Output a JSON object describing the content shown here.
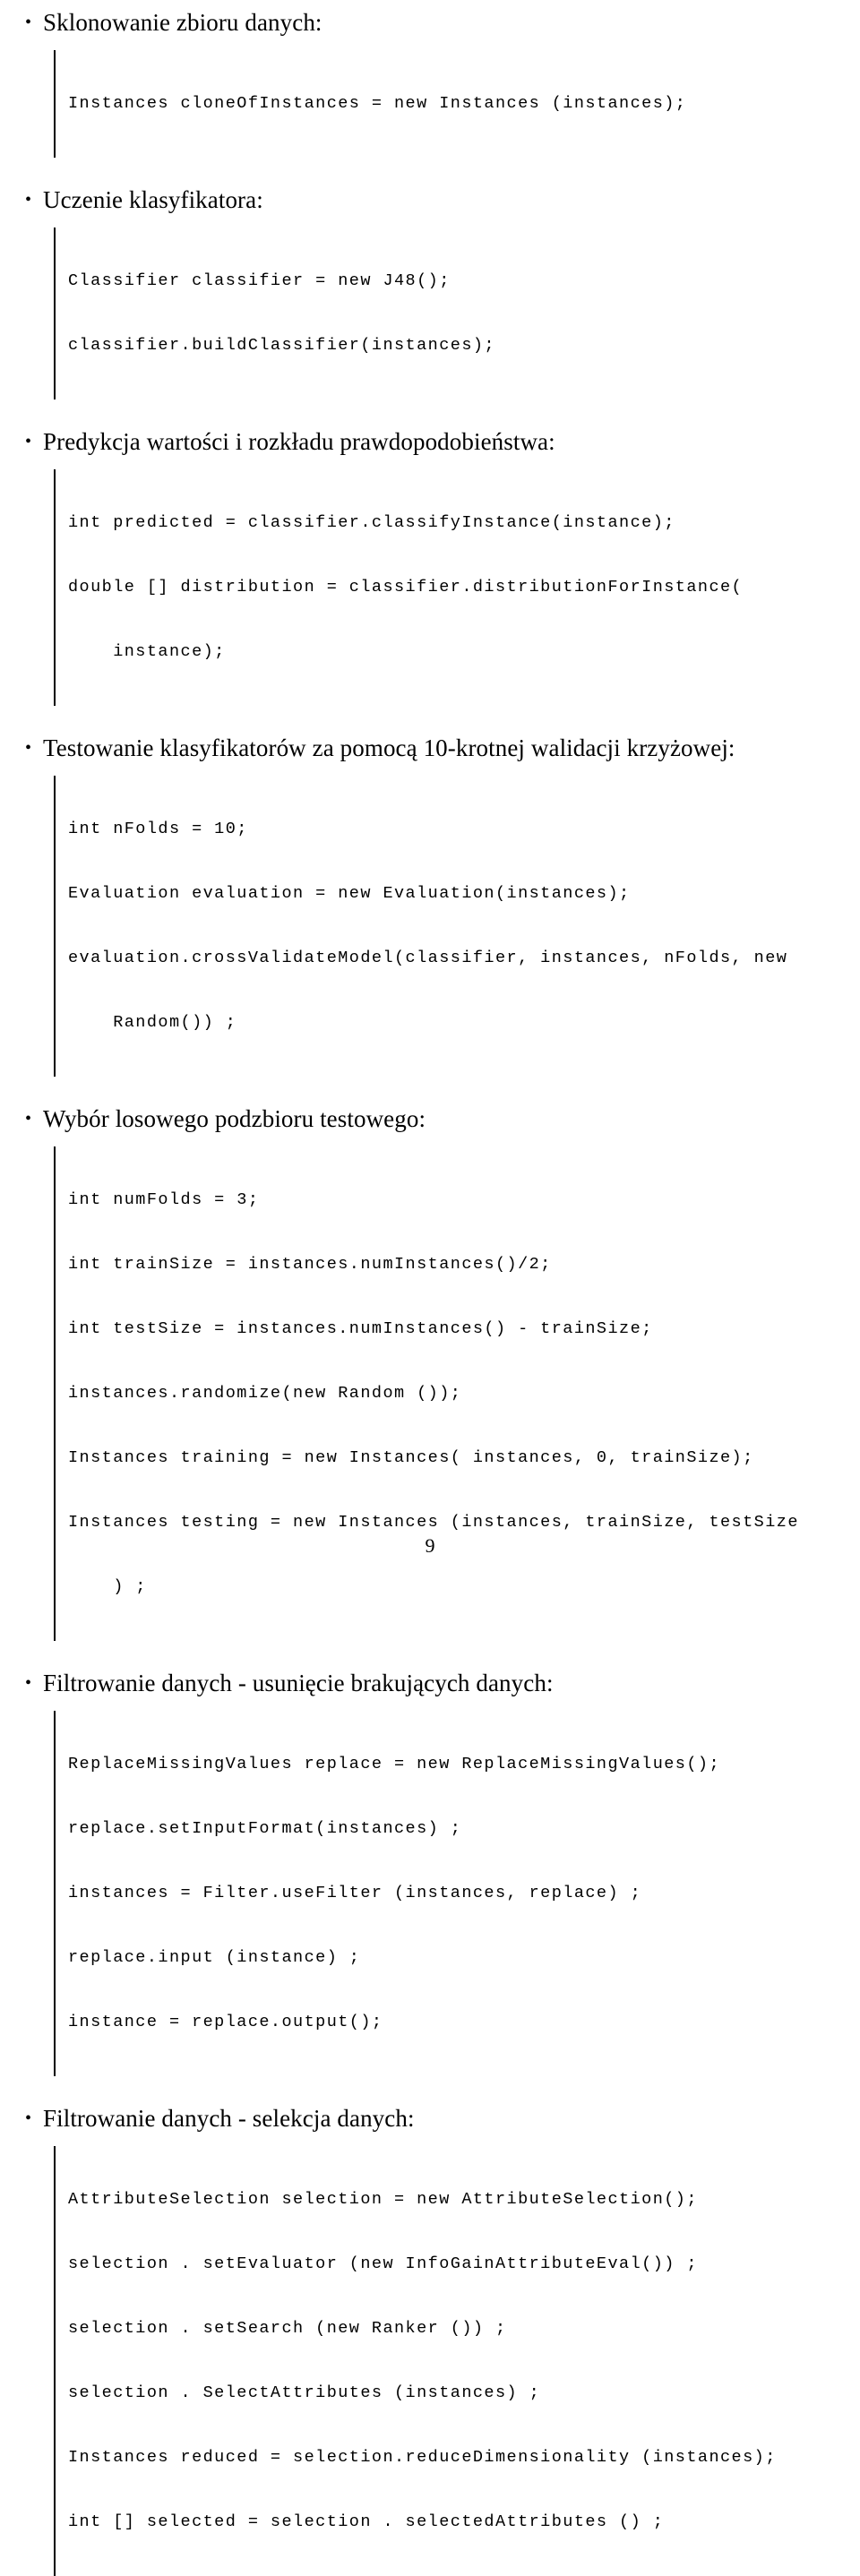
{
  "document": {
    "language": "pl",
    "page_number": "9",
    "sections": [
      {
        "heading": "Sklonowanie zbioru danych:",
        "code": [
          "Instances cloneOfInstances = new Instances (instances);"
        ]
      },
      {
        "heading": "Uczenie klasyfikatora:",
        "code": [
          "Classifier classifier = new J48();",
          "classifier.buildClassifier(instances);"
        ]
      },
      {
        "heading": "Predykcja wartości i rozkładu prawdopodobieństwa:",
        "code": [
          "int predicted = classifier.classifyInstance(instance);",
          "double [] distribution = classifier.distributionForInstance(",
          "    instance);"
        ]
      },
      {
        "heading": "Testowanie klasyfikatorów za pomocą 10-krotnej walidacji krzyżowej:",
        "code": [
          "int nFolds = 10;",
          "Evaluation evaluation = new Evaluation(instances);",
          "evaluation.crossValidateModel(classifier, instances, nFolds, new",
          "    Random()) ;"
        ]
      },
      {
        "heading": "Wybór losowego podzbioru testowego:",
        "code": [
          "int numFolds = 3;",
          "int trainSize = instances.numInstances()/2;",
          "int testSize = instances.numInstances() - trainSize;",
          "instances.randomize(new Random ());",
          "Instances training = new Instances( instances, 0, trainSize);",
          "Instances testing = new Instances (instances, trainSize, testSize",
          "    ) ;"
        ]
      },
      {
        "heading": "Filtrowanie danych - usunięcie brakujących danych:",
        "code": [
          "ReplaceMissingValues replace = new ReplaceMissingValues();",
          "replace.setInputFormat(instances) ;",
          "instances = Filter.useFilter (instances, replace) ;",
          "replace.input (instance) ;",
          "instance = replace.output();"
        ]
      },
      {
        "heading": "Filtrowanie danych - selekcja danych:",
        "code": [
          "AttributeSelection selection = new AttributeSelection();",
          "selection . setEvaluator (new InfoGainAttributeEval()) ;",
          "selection . setSearch (new Ranker ()) ;",
          "selection . SelectAttributes (instances) ;",
          "Instances reduced = selection.reduceDimensionality (instances);",
          "int [] selected = selection . selectedAttributes () ;"
        ]
      }
    ],
    "bullet_glyph": "•"
  }
}
